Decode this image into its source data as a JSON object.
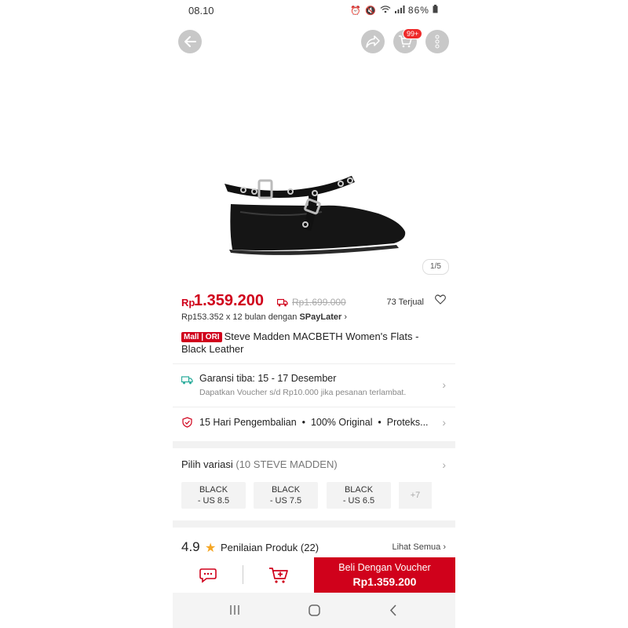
{
  "status_bar": {
    "time": "08.10",
    "icons_text": "Vo) LTE1",
    "battery": "86%"
  },
  "header": {
    "cart_badge": "99+"
  },
  "gallery": {
    "counter": "1/5"
  },
  "product": {
    "currency": "Rp",
    "price": "1.359.200",
    "original_price": "Rp1.699.000",
    "sold": "73 Terjual",
    "paylater_prefix": "Rp153.352 x 12 bulan dengan",
    "paylater_brand": "SPayLater",
    "mall_badge": "Mall | ORI",
    "title": "Steve Madden MACBETH Women's Flats - Black Leather"
  },
  "guarantee": {
    "title": "Garansi tiba: 15 - 17 Desember",
    "subtitle": "Dapatkan Voucher s/d Rp10.000 jika pesanan terlambat."
  },
  "protection": {
    "text": "15 Hari Pengembalian  •  100% Original  •  Proteks..."
  },
  "variations": {
    "label": "Pilih variasi",
    "count": "(10 STEVE MADDEN)",
    "options": [
      {
        "color": "BLACK",
        "size": "- US 8.5"
      },
      {
        "color": "BLACK",
        "size": "- US 7.5"
      },
      {
        "color": "BLACK",
        "size": "- US 6.5"
      }
    ],
    "more": "+7"
  },
  "rating": {
    "score": "4.9",
    "label": "Penilaian Produk",
    "count": "(22)",
    "see_all": "Lihat Semua"
  },
  "bottom_bar": {
    "buy_label": "Beli Dengan Voucher",
    "buy_price": "Rp1.359.200"
  },
  "colors": {
    "accent": "#d0011b",
    "guarantee_green": "#26aa99",
    "star": "#f5a623"
  }
}
